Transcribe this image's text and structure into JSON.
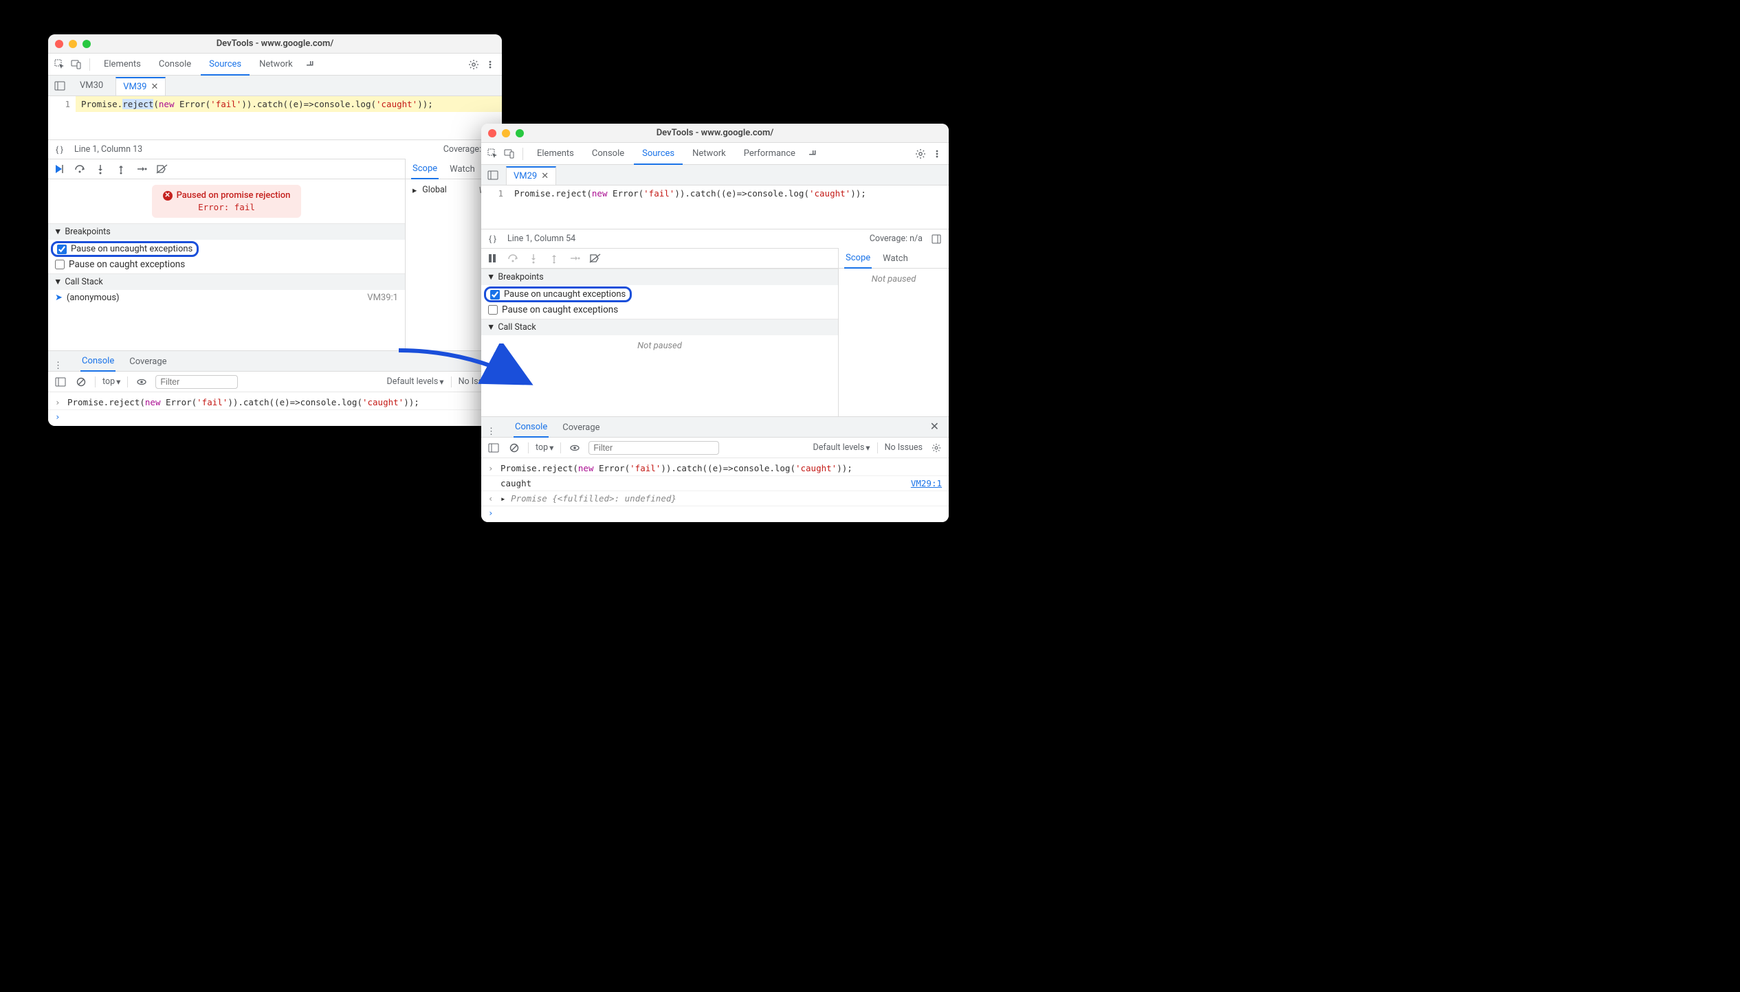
{
  "left": {
    "title": "DevTools - www.google.com/",
    "panels": [
      "Elements",
      "Console",
      "Sources",
      "Network"
    ],
    "activePanel": "Sources",
    "fileTabs": [
      "VM30",
      "VM39"
    ],
    "activeFileTab": "VM39",
    "code": {
      "lineNo": "1",
      "pre": "Promise.",
      "sel": "reject",
      "post1": "(",
      "kwNew": "new",
      "post2": " Error(",
      "str1": "'fail'",
      "post3": ")).catch((e)=>console.log(",
      "str2": "'caught'",
      "post4": "));"
    },
    "status": {
      "line": "Line 1, Column 13",
      "coverage": "Coverage: n/a"
    },
    "pauseMsg": {
      "title": "Paused on promise rejection",
      "error": "Error: fail"
    },
    "breakpoints": {
      "header": "Breakpoints",
      "uncaught": "Pause on uncaught exceptions",
      "caught": "Pause on caught exceptions"
    },
    "callStack": {
      "header": "Call Stack",
      "frameName": "(anonymous)",
      "frameLoc": "VM39:1"
    },
    "scope": {
      "tabs": [
        "Scope",
        "Watch"
      ],
      "global": "Global",
      "globalVal": "Win"
    },
    "drawer": {
      "tabs": [
        "Console",
        "Coverage"
      ],
      "context": "top",
      "filterPlaceholder": "Filter",
      "levels": "Default levels",
      "issues": "No Issues"
    },
    "console": {
      "inputPre": "Promise.reject(",
      "kwNew": "new",
      "inputMid": " Error(",
      "str1": "'fail'",
      "inputMid2": ")).catch((e)=>console.log(",
      "str2": "'caught'",
      "inputEnd": "));"
    }
  },
  "right": {
    "title": "DevTools - www.google.com/",
    "panels": [
      "Elements",
      "Console",
      "Sources",
      "Network",
      "Performance"
    ],
    "activePanel": "Sources",
    "fileTabs": [
      "VM29"
    ],
    "activeFileTab": "VM29",
    "code": {
      "lineNo": "1",
      "pre": "Promise.reject(",
      "kwNew": "new",
      "post2": " Error(",
      "str1": "'fail'",
      "post3": ")).catch((e)=>console.log(",
      "str2": "'caught'",
      "post4": "));"
    },
    "status": {
      "line": "Line 1, Column 54",
      "coverage": "Coverage: n/a"
    },
    "breakpoints": {
      "header": "Breakpoints",
      "uncaught": "Pause on uncaught exceptions",
      "caught": "Pause on caught exceptions"
    },
    "callStack": {
      "header": "Call Stack",
      "notPaused": "Not paused"
    },
    "scope": {
      "tabs": [
        "Scope",
        "Watch"
      ],
      "notPaused": "Not paused"
    },
    "drawer": {
      "tabs": [
        "Console",
        "Coverage"
      ],
      "context": "top",
      "filterPlaceholder": "Filter",
      "levels": "Default levels",
      "issues": "No Issues"
    },
    "console": {
      "inputPre": "Promise.reject(",
      "kwNew": "new",
      "inputMid": " Error(",
      "str1": "'fail'",
      "inputMid2": ")).catch((e)=>console.log(",
      "str2": "'caught'",
      "inputEnd": "));",
      "output": "caught",
      "outputLoc": "VM29:1",
      "ret1": "Promise {",
      "ret2": "<fulfilled>",
      "ret3": ": ",
      "ret4": "undefined",
      "ret5": "}"
    }
  }
}
